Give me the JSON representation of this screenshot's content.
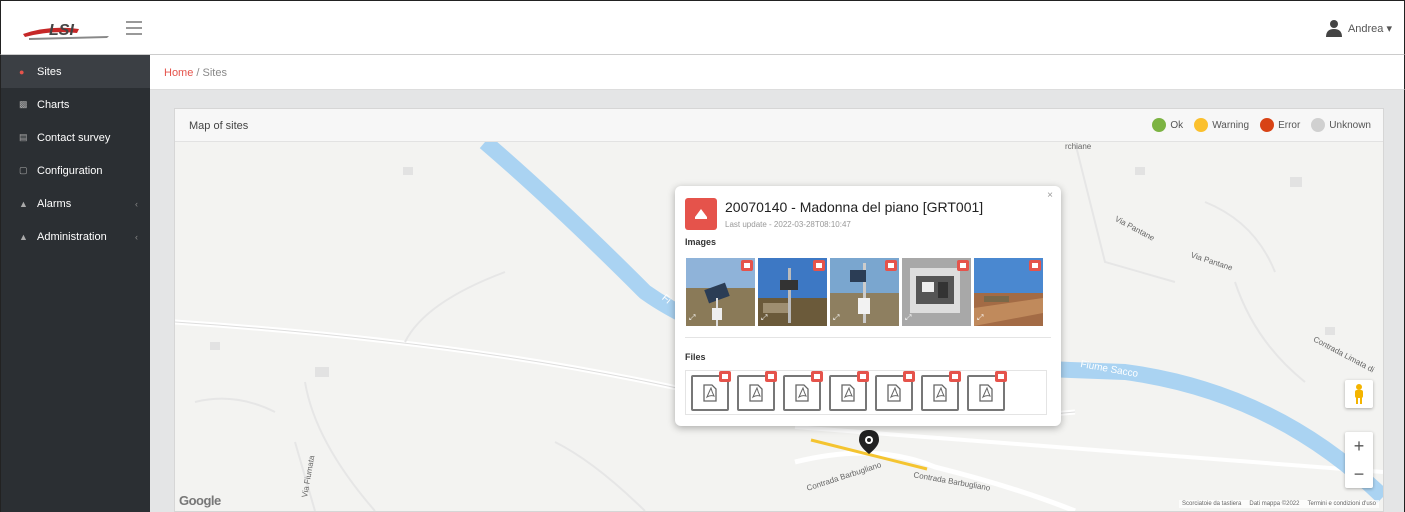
{
  "header": {
    "user_name": "Andrea ▾"
  },
  "sidebar": {
    "items": [
      {
        "label": "Sites",
        "icon": "map-pin-icon",
        "active": true
      },
      {
        "label": "Charts",
        "icon": "chart-icon"
      },
      {
        "label": "Contact survey",
        "icon": "table-icon"
      },
      {
        "label": "Configuration",
        "icon": "file-icon"
      },
      {
        "label": "Alarms",
        "icon": "bell-icon",
        "chevron": "‹"
      },
      {
        "label": "Administration",
        "icon": "user-icon",
        "chevron": "‹"
      }
    ]
  },
  "breadcrumb": {
    "home": "Home",
    "separator": "/",
    "current": "Sites"
  },
  "card": {
    "title": "Map of sites",
    "legend": [
      {
        "label": "Ok",
        "color": "#7cb342"
      },
      {
        "label": "Warning",
        "color": "#fbc02d"
      },
      {
        "label": "Error",
        "color": "#d84315"
      },
      {
        "label": "Unknown",
        "color": "#d0d0d0"
      }
    ]
  },
  "popup": {
    "close": "×",
    "title": "20070140 - Madonna del piano [GRT001]",
    "subtitle": "Last update - 2022-03-28T08:10:47",
    "images_label": "Images",
    "files_label": "Files",
    "images": [
      {
        "name": "solar-panel-field"
      },
      {
        "name": "station-sky"
      },
      {
        "name": "solar-panel-pole"
      },
      {
        "name": "logger-box"
      },
      {
        "name": "field-view"
      }
    ],
    "files": [
      "pdf",
      "pdf",
      "pdf",
      "pdf",
      "pdf",
      "pdf",
      "pdf"
    ]
  },
  "map": {
    "labels": {
      "fiume_sacco": "Fiume Sacco",
      "via_pantane_1": "Via Pantane",
      "via_pantane_2": "Via Pantane",
      "contrada_limata": "Contrada Limata di",
      "contrada_barbugliano_1": "Contrada Barbugliano",
      "contrada_barbugliano_2": "Contrada Barbugliano",
      "via_fiumata": "Via Fiumata",
      "river_fi": "Fi",
      "top_partial": "rchiane"
    },
    "google": "Google",
    "attribution": [
      "Scorciatoie da tastiera",
      "Dati mappa ©2022",
      "Termini e condizioni d'uso"
    ],
    "zoom_in": "+",
    "zoom_out": "−"
  }
}
